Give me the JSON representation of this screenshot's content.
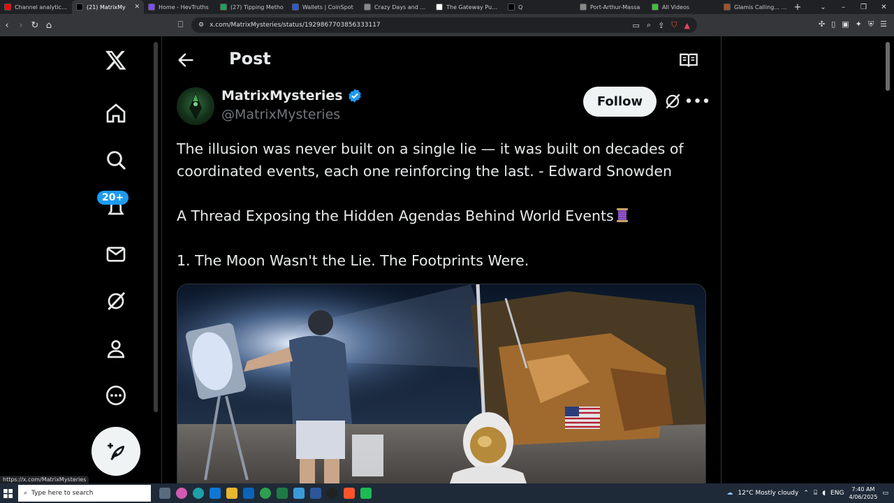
{
  "browser": {
    "tabs": [
      {
        "label": "Channel analytics -",
        "color": "#ff0000"
      },
      {
        "label": "(21) MatrixMy",
        "color": "#000000",
        "active": true
      },
      {
        "label": "Home - HevTruths",
        "color": "#7b4cff"
      },
      {
        "label": "(27) Tipping Metho",
        "color": "#1aa260"
      },
      {
        "label": "Wallets | CoinSpot",
        "color": "#2a5bd7"
      },
      {
        "label": "Crazy Days and Nig",
        "color": "#888888"
      },
      {
        "label": "The Gateway Pundi",
        "color": "#ffffff"
      },
      {
        "label": "Q",
        "color": "#000000"
      },
      {
        "label": "Port-Arthur-Massa",
        "color": "#888888"
      },
      {
        "label": "All Videos",
        "color": "#3fbf3f"
      },
      {
        "label": "Glamis Calling... | ta",
        "color": "#a0522d"
      }
    ],
    "new_tab": "+",
    "url": "x.com/MatrixMysteries/status/1929867703856333117",
    "status_url": "https://x.com/MatrixMysteries"
  },
  "sidebar": {
    "notifications_badge": "20+"
  },
  "header": {
    "title": "Post"
  },
  "post": {
    "display_name": "MatrixMysteries",
    "handle": "@MatrixMysteries",
    "follow_label": "Follow",
    "lines": [
      "The illusion was never built on a single lie — it was built on decades of",
      "coordinated events, each one reinforcing the last. - Edward Snowden",
      "A Thread Exposing the Hidden Agendas Behind World Events",
      "1. The Moon Wasn't the Lie. The Footprints Were."
    ]
  },
  "taskbar": {
    "search_placeholder": "Type here to search",
    "weather": "12°C  Mostly cloudy",
    "lang": "ENG",
    "time": "7:40 AM",
    "date": "4/06/2025"
  },
  "colors": {
    "accent": "#1d9bf0",
    "background": "#000000",
    "text": "#e7e9ea",
    "muted": "#71767b",
    "border": "#2f3336"
  }
}
